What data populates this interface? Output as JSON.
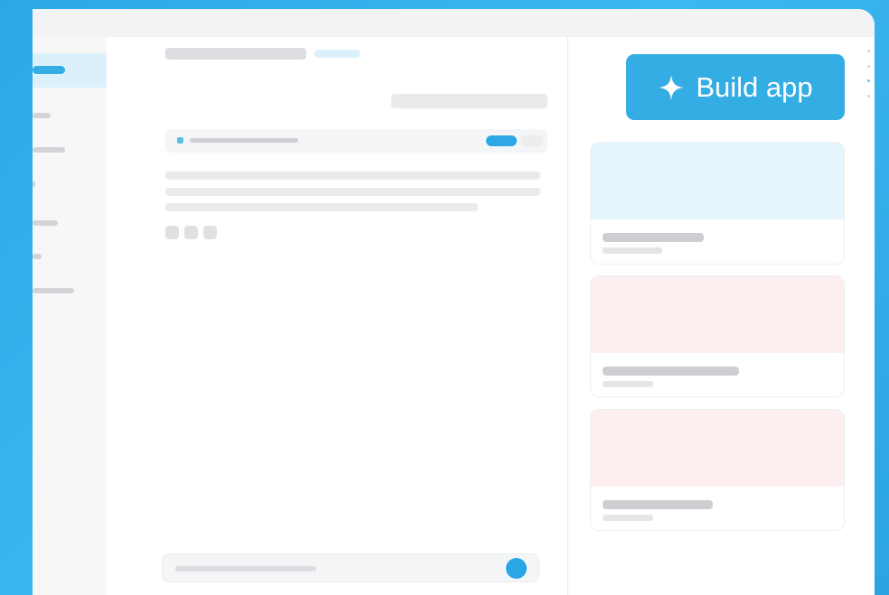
{
  "build_button": {
    "label": "Build app",
    "icon": "sparkle-icon"
  },
  "colors": {
    "accent": "#33ade4",
    "background": "#2ba7e6",
    "card_thumb_blue": "#e4f5fd",
    "card_thumb_pink": "#fdeef0"
  },
  "app_cards": [
    {
      "thumb_color": "#e4f5fd"
    },
    {
      "thumb_color": "#fdeef0"
    },
    {
      "thumb_color": "#fdeef0"
    }
  ]
}
